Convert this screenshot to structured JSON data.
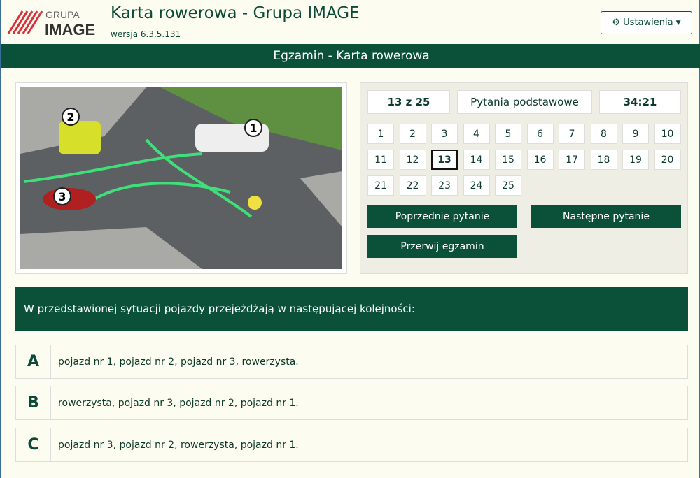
{
  "header": {
    "logo_top": "GRUPA",
    "logo_bottom": "IMAGE",
    "title": "Karta rowerowa - Grupa IMAGE",
    "version": "wersja 6.3.5.131",
    "settings_label": "Ustawienia"
  },
  "bar": {
    "title": "Egzamin - Karta rowerowa"
  },
  "scene": {
    "labels": [
      "1",
      "2",
      "3"
    ]
  },
  "status": {
    "progress": "13 z 25",
    "category": "Pytania podstawowe",
    "timer": "34:21"
  },
  "questions": {
    "current": 13,
    "numbers": [
      "1",
      "2",
      "3",
      "4",
      "5",
      "6",
      "7",
      "8",
      "9",
      "10",
      "11",
      "12",
      "13",
      "14",
      "15",
      "16",
      "17",
      "18",
      "19",
      "20",
      "21",
      "22",
      "23",
      "24",
      "25"
    ]
  },
  "buttons": {
    "prev": "Poprzednie pytanie",
    "next": "Następne pytanie",
    "abort": "Przerwij egzamin"
  },
  "question": "W przedstawionej sytuacji pojazdy przejeżdżają w następującej kolejności:",
  "answers": [
    {
      "letter": "A",
      "text": "pojazd nr 1, pojazd nr 2, pojazd nr 3, rowerzysta."
    },
    {
      "letter": "B",
      "text": "rowerzysta, pojazd nr 3, pojazd nr 2, pojazd nr 1."
    },
    {
      "letter": "C",
      "text": "pojazd nr 3, pojazd nr 2, rowerzysta, pojazd nr 1."
    }
  ]
}
